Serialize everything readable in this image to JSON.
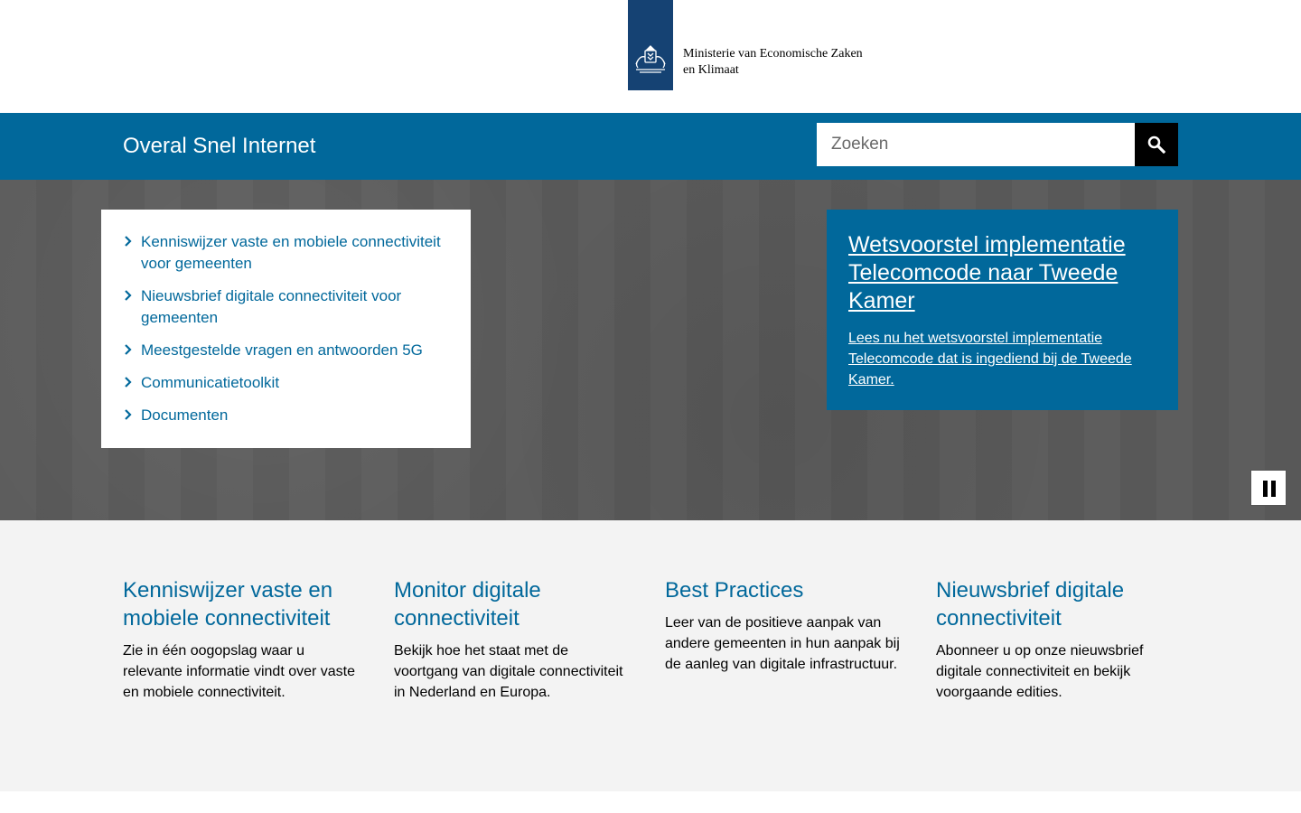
{
  "header": {
    "ministry_line1": "Ministerie van Economische Zaken",
    "ministry_line2": "en Klimaat",
    "logo_icon": "coat-of-arms-icon",
    "logo_color": "#154273"
  },
  "site_bar": {
    "title": "Overal Snel Internet",
    "search_placeholder": "Zoeken",
    "search_icon": "search-icon",
    "bar_color": "#01689b"
  },
  "quicklinks": [
    {
      "label": "Kenniswijzer vaste en mobiele connectiviteit voor gemeenten"
    },
    {
      "label": "Nieuwsbrief digitale connectiviteit voor gemeenten"
    },
    {
      "label": "Meestgestelde vragen en antwoorden 5G"
    },
    {
      "label": "Communicatietoolkit"
    },
    {
      "label": "Documenten"
    }
  ],
  "spotlight": {
    "title": "Wetsvoorstel implementatie Telecomcode naar Tweede Kamer",
    "text": "Lees nu het wetsvoorstel implementatie Telecomcode dat is ingediend bij de Tweede Kamer."
  },
  "carousel": {
    "pause_icon": "pause-icon"
  },
  "features": [
    {
      "title": "Kenniswijzer vaste en mobiele connectiviteit",
      "text": "Zie in één oogopslag waar u relevante informatie vindt over vaste en mobiele connectiviteit."
    },
    {
      "title": "Monitor digitale connectiviteit",
      "text": "Bekijk hoe het staat met de voortgang van digitale connectiviteit in Nederland en Europa."
    },
    {
      "title": "Best Practices",
      "text": "Leer van de positieve aanpak van andere gemeenten in hun aanpak bij de aanleg van digitale infrastructuur."
    },
    {
      "title": "Nieuwsbrief digitale connectiviteit",
      "text": "Abonneer u op onze nieuwsbrief digitale connectiviteit en bekijk voorgaande edities."
    }
  ]
}
